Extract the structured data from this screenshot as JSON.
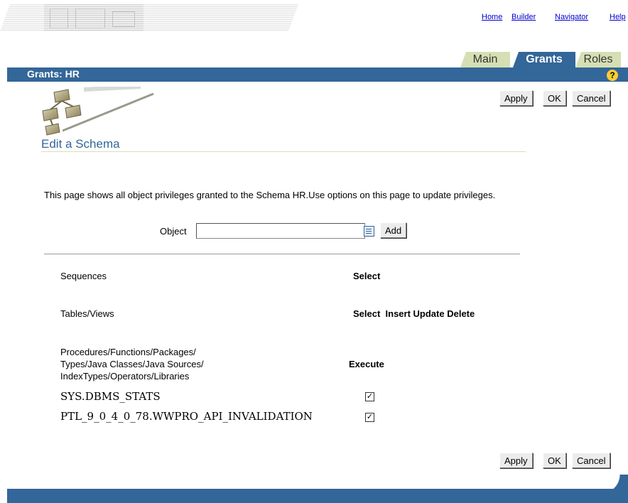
{
  "global_links": [
    "Home",
    "Builder",
    "Navigator",
    "Help"
  ],
  "tabs": [
    {
      "label": "Main",
      "active": false
    },
    {
      "label": "Grants",
      "active": true
    },
    {
      "label": "Roles",
      "active": false
    }
  ],
  "title_bar": {
    "title": "Grants: HR",
    "help_icon": "question-mark-icon"
  },
  "buttons": {
    "apply": "Apply",
    "ok": "OK",
    "cancel": "Cancel",
    "add": "Add"
  },
  "section_title": "Edit a Schema",
  "description": "This page shows all object privileges granted to the Schema HR.Use options on this page to update privileges.",
  "object_field": {
    "label": "Object",
    "value": ""
  },
  "privilege_rows": [
    {
      "label": "Sequences",
      "privileges": "Select"
    },
    {
      "label": "Tables/Views",
      "privileges": "Select  Insert Update Delete"
    },
    {
      "label_lines": [
        "Procedures/Functions/Packages/",
        "Types/Java Classes/Java Sources/",
        "IndexTypes/Operators/Libraries"
      ],
      "privileges": "Execute"
    }
  ],
  "execute_objects": [
    {
      "name": "SYS.DBMS_STATS",
      "checked": true
    },
    {
      "name": "PTL_9_0_4_0_78.WWPRO_API_INVALIDATION",
      "checked": true
    }
  ],
  "colors": {
    "accent": "#336699",
    "tab_inactive": "#d6dfb4",
    "link": "#0000cc",
    "help_icon": "#ffcc33"
  }
}
